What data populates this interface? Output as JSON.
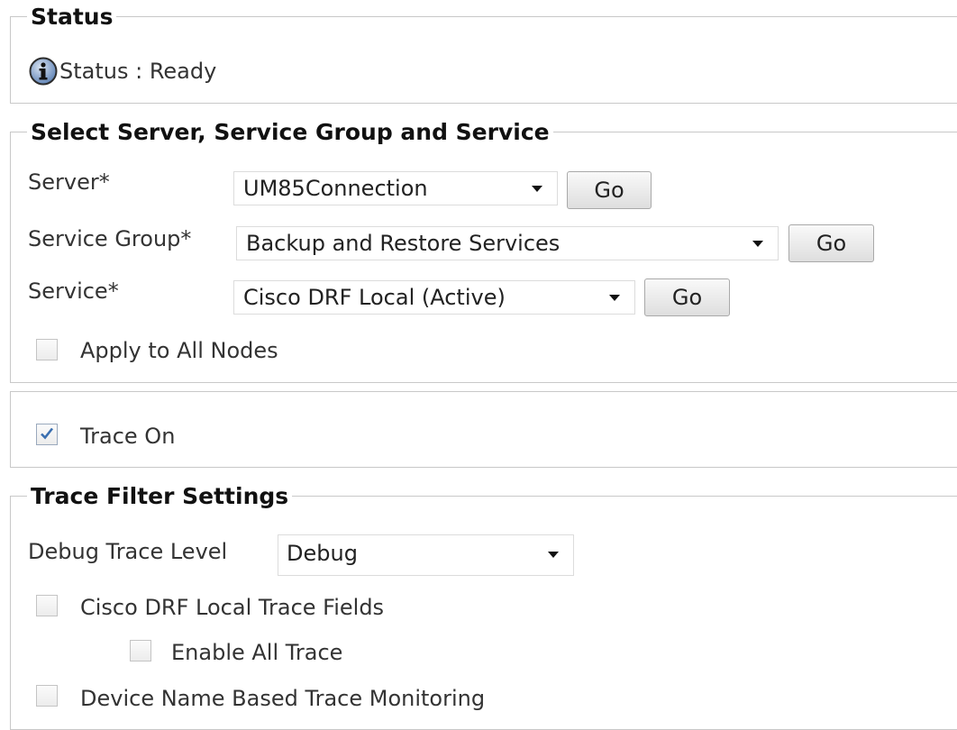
{
  "status_section": {
    "legend": "Status",
    "icon": "info-icon",
    "status_text": "Status : Ready"
  },
  "select_section": {
    "legend": "Select Server, Service Group and Service",
    "server": {
      "label": "Server*",
      "value": "UM85Connection",
      "go": "Go"
    },
    "service_group": {
      "label": "Service Group*",
      "value": "Backup and Restore Services",
      "go": "Go"
    },
    "service": {
      "label": "Service*",
      "value": "Cisco DRF Local (Active)",
      "go": "Go"
    },
    "apply_all": {
      "label": "Apply to All Nodes",
      "checked": false,
      "enabled": false
    }
  },
  "trace_on": {
    "label": "Trace On",
    "checked": true
  },
  "trace_filter": {
    "legend": "Trace Filter Settings",
    "debug_level": {
      "label": "Debug Trace Level",
      "value": "Debug"
    },
    "local_trace_fields": {
      "label": "Cisco DRF Local Trace Fields",
      "checked": false
    },
    "enable_all_trace": {
      "label": "Enable All Trace",
      "checked": false
    },
    "device_name_monitoring": {
      "label": "Device Name Based Trace Monitoring",
      "checked": false
    }
  },
  "colors": {
    "border": "#c8c8c8",
    "check_mark": "#3a6fb0",
    "info_icon": "#5a7fb3"
  }
}
